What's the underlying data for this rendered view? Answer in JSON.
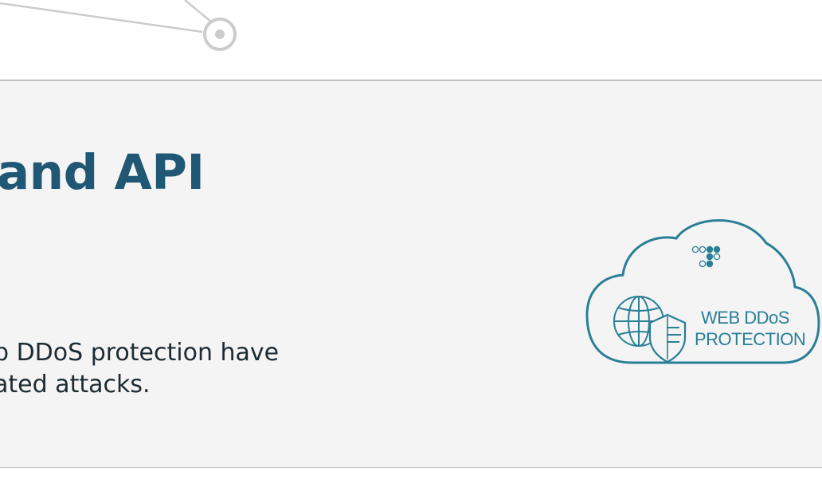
{
  "hero": {
    "heading": "and API",
    "body_lines": [
      "b DDoS protection have",
      "ated attacks."
    ]
  },
  "badge": {
    "icon": "web-ddos-protection-cloud-icon",
    "line1": "WEB DDoS",
    "line2": "PROTECTION"
  },
  "colors": {
    "heading": "#1f5775",
    "body_text": "#1c2b33",
    "band_background": "#f4f4f4",
    "badge_accent": "#2a7f96",
    "network_lines": "#cccccc"
  }
}
